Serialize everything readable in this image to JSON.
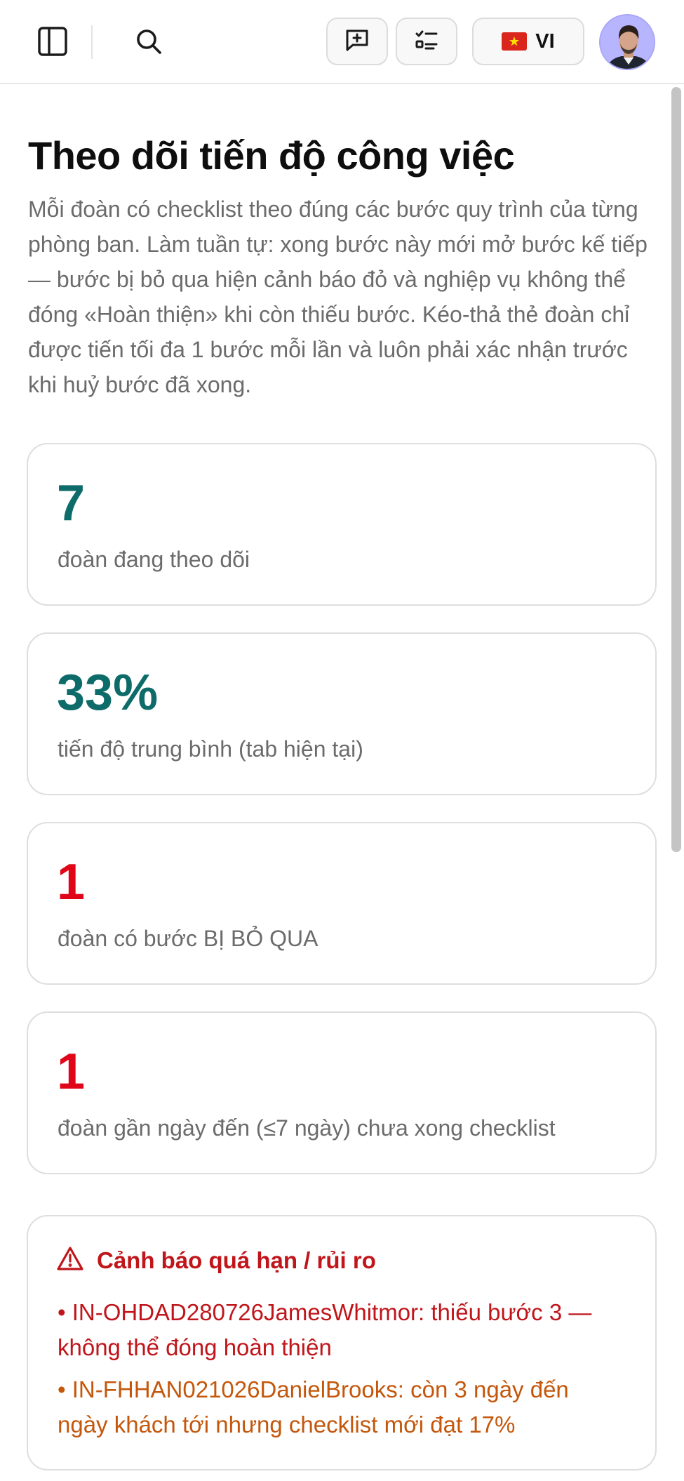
{
  "topbar": {
    "sidebar_icon": "sidebar-panel-icon",
    "search_icon": "search-icon",
    "feedback_icon": "message-plus-icon",
    "checklist_icon": "checklist-icon",
    "language": {
      "flag": "vietnam-flag-icon",
      "label": "VI"
    },
    "avatar": "user-avatar"
  },
  "page": {
    "title": "Theo dõi tiến độ công việc",
    "description": "Mỗi đoàn có checklist theo đúng các bước quy trình của từng phòng ban. Làm tuần tự: xong bước này mới mở bước kế tiếp — bước bị bỏ qua hiện cảnh báo đỏ và nghiệp vụ không thể đóng «Hoàn thiện» khi còn thiếu bước. Kéo-thả thẻ đoàn chỉ được tiến tối đa 1 bước mỗi lần và luôn phải xác nhận trước khi huỷ bước đã xong."
  },
  "stats": [
    {
      "value": "7",
      "label": "đoàn đang theo dõi",
      "color": "#0d6b6a"
    },
    {
      "value": "33%",
      "label": "tiến độ trung bình (tab hiện tại)",
      "color": "#0d6b6a"
    },
    {
      "value": "1",
      "label": "đoàn có bước BỊ BỎ QUA",
      "color": "#e0061a"
    },
    {
      "value": "1",
      "label": "đoàn gần ngày đến (≤7 ngày) chưa xong checklist",
      "color": "#e0061a"
    }
  ],
  "alerts": {
    "icon": "warning-triangle-icon",
    "title": "Cảnh báo quá hạn / rủi ro",
    "items": [
      {
        "text": "• IN-OHDAD280726JamesWhitmor: thiếu bước 3 — không thể đóng hoàn thiện",
        "color": "#c0151a"
      },
      {
        "text": "• IN-FHHAN021026DanielBrooks: còn 3 ngày đến ngày khách tới nhưng checklist mới đạt 17%",
        "color": "#c4570c"
      }
    ]
  }
}
